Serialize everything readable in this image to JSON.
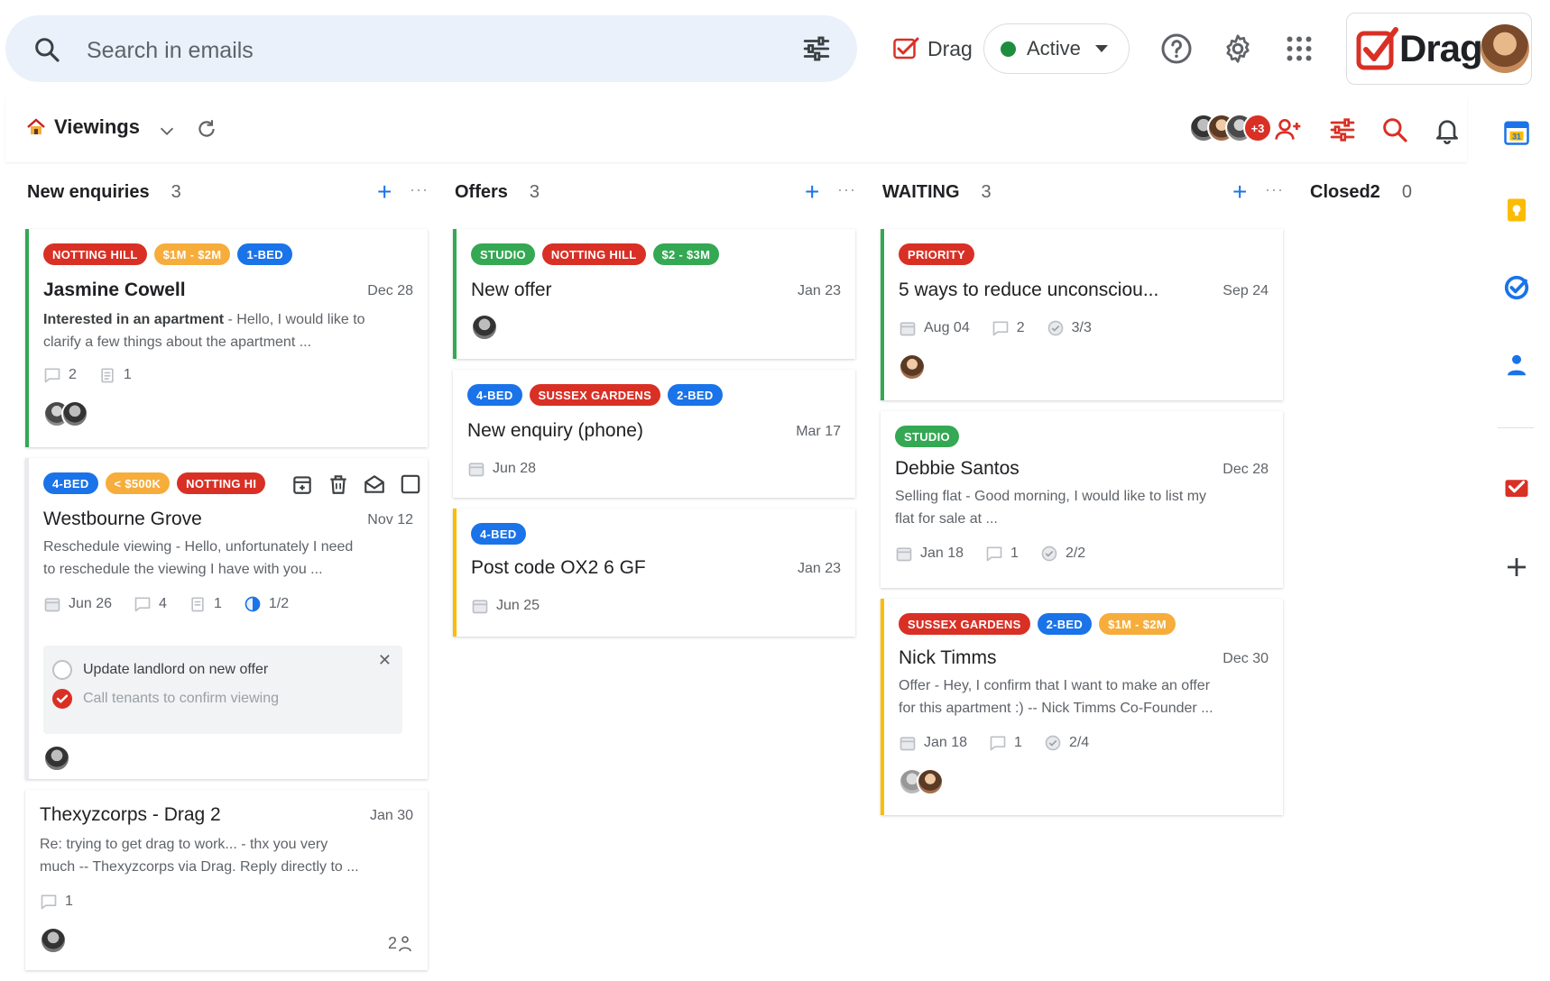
{
  "search": {
    "placeholder": "Search in emails"
  },
  "topbar": {
    "drag_label": "Drag",
    "status": "Active",
    "brand": "Drag"
  },
  "board": {
    "title": "Viewings",
    "extra_members": "+3"
  },
  "columns": [
    {
      "name": "New enquiries",
      "count": "3"
    },
    {
      "name": "Offers",
      "count": "3"
    },
    {
      "name": "WAITING",
      "count": "3"
    },
    {
      "name": "Closed2",
      "count": "0"
    }
  ],
  "cards": {
    "jasmine": {
      "tags": [
        "NOTTING HILL",
        "$1M - $2M",
        "1-BED"
      ],
      "title": "Jasmine Cowell",
      "date": "Dec 28",
      "subject": "Interested in an apartment",
      "snippet_line1": " - Hello, I would like to",
      "snippet_line2": "clarify a few things about the apartment ...",
      "comments": "2",
      "notes": "1"
    },
    "westbourne": {
      "tags": [
        "4-BED",
        "< $500K",
        "NOTTING HI"
      ],
      "title": "Westbourne Grove",
      "date": "Nov 12",
      "snippet_line1": "Reschedule viewing - Hello, unfortunately I need",
      "snippet_line2": "to reschedule the viewing I have with you ...",
      "due": "Jun 26",
      "comments": "4",
      "notes": "1",
      "tasks_progress": "1/2",
      "tasks": [
        {
          "label": "Update landlord on new offer",
          "done": false
        },
        {
          "label": "Call tenants to confirm viewing",
          "done": true
        }
      ]
    },
    "thexyz": {
      "title": "Thexyzcorps - Drag  2",
      "date": "Jan 30",
      "snippet_line1": "Re: trying to get drag to work... - thx you very",
      "snippet_line2": "much -- Thexyzcorps via Drag. Reply directly to ...",
      "comments": "1",
      "assign_count": "2"
    },
    "new_offer": {
      "tags": [
        "STUDIO",
        "NOTTING HILL",
        "$2 - $3M"
      ],
      "title": "New offer",
      "date": "Jan 23"
    },
    "new_enquiry": {
      "tags": [
        "4-BED",
        "SUSSEX GARDENS",
        "2-BED"
      ],
      "title": "New enquiry (phone)",
      "date": "Mar 17",
      "due": "Jun 28"
    },
    "postcode": {
      "tags": [
        "4-BED"
      ],
      "title": "Post code OX2 6 GF",
      "date": "Jan 23",
      "due": "Jun 25"
    },
    "five_ways": {
      "tags": [
        "PRIORITY"
      ],
      "title": "5 ways to reduce unconsciou...",
      "date": "Sep 24",
      "due": "Aug 04",
      "comments": "2",
      "tasks_progress": "3/3"
    },
    "debbie": {
      "tags": [
        "STUDIO"
      ],
      "title": "Debbie Santos",
      "date": "Dec 28",
      "snippet_line1": "Selling flat - Good morning, I would like to list my",
      "snippet_line2": "flat for sale at ...",
      "due": "Jan 18",
      "comments": "1",
      "tasks_progress": "2/2"
    },
    "nick": {
      "tags": [
        "SUSSEX GARDENS",
        "2-BED",
        "$1M - $2M"
      ],
      "title": "Nick Timms",
      "date": "Dec 30",
      "snippet_line1": "Offer - Hey, I confirm that I want to make an offer",
      "snippet_line2": "for this apartment :) -- Nick Timms Co-Founder ...",
      "due": "Jan 18",
      "comments": "1",
      "tasks_progress": "2/4"
    }
  },
  "colors": {
    "accent_blue": "#1a73e8",
    "tag_red": "#d93025",
    "tag_orange": "#f6ad3b",
    "tag_green": "#34a853",
    "card_border_green": "#34a853",
    "card_border_orange": "#fbbc04"
  },
  "icons": [
    "search-icon",
    "tune-icon",
    "help-icon",
    "settings-icon",
    "apps-icon",
    "refresh-icon",
    "bell-icon",
    "calendar-icon",
    "keep-icon",
    "tasks-icon",
    "contacts-icon",
    "drag-icon",
    "plus-icon"
  ]
}
